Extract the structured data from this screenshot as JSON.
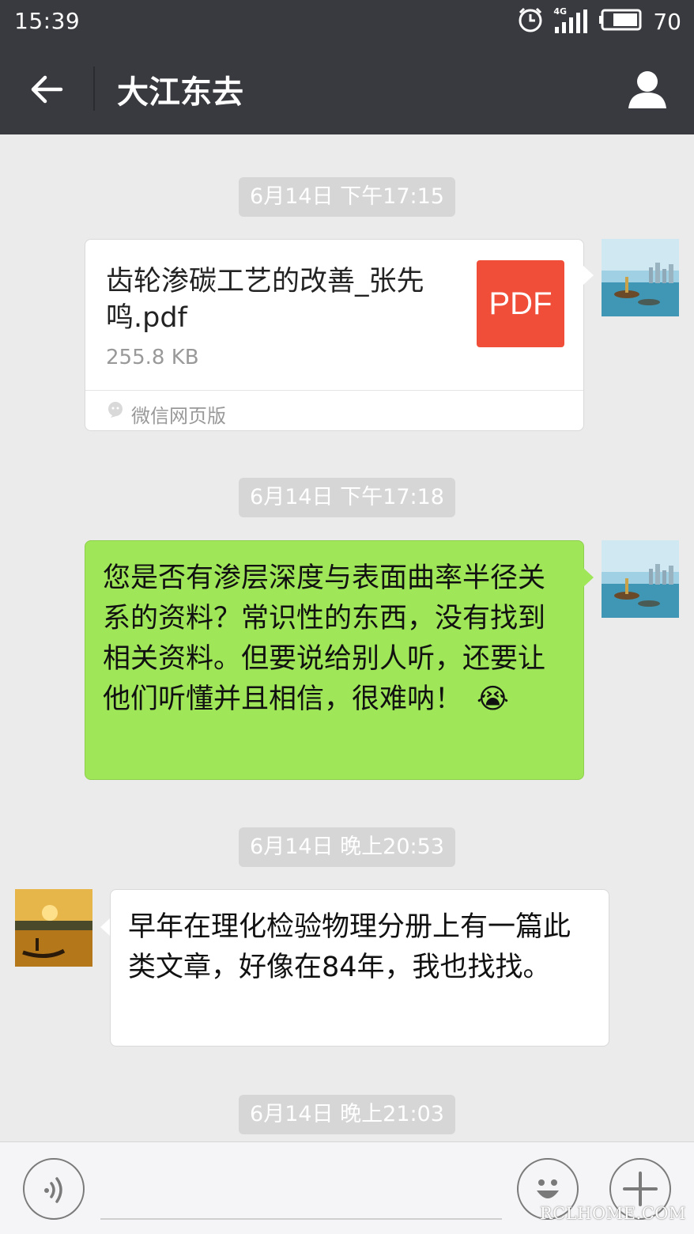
{
  "status_bar": {
    "time": "15:39",
    "network": "4G",
    "battery": "70",
    "icons": [
      "alarm-icon",
      "signal-icon",
      "battery-icon"
    ]
  },
  "header": {
    "title": "大江东去",
    "back_icon": "back-arrow-icon",
    "profile_icon": "profile-icon"
  },
  "messages": {
    "ts1": "6月14日 下午17:15",
    "file": {
      "name": "齿轮渗碳工艺的改善_张先鸣.pdf",
      "size": "255.8 KB",
      "type_label": "PDF",
      "source": "微信网页版"
    },
    "ts2": "6月14日 下午17:18",
    "sent_text": "您是否有渗层深度与表面曲率半径关系的资料？常识性的东西，没有找到相关资料。但要说给别人听，还要让他们听懂并且相信，很难呐！",
    "sent_emoji": "😭",
    "ts3": "6月14日 晚上20:53",
    "received_text": "早年在理化检验物理分册上有一篇此类文章，好像在84年，我也找找。",
    "ts4": "6月14日 晚上21:03"
  },
  "input_bar": {
    "voice_icon": "voice-icon",
    "emoji_icon": "emoji-icon",
    "plus_icon": "plus-icon"
  },
  "watermark": "RCLHOME.COM",
  "colors": {
    "header_bg": "#393a3f",
    "chat_bg": "#ebebeb",
    "sent_bubble": "#9fe658",
    "pdf_red": "#f04e38"
  }
}
